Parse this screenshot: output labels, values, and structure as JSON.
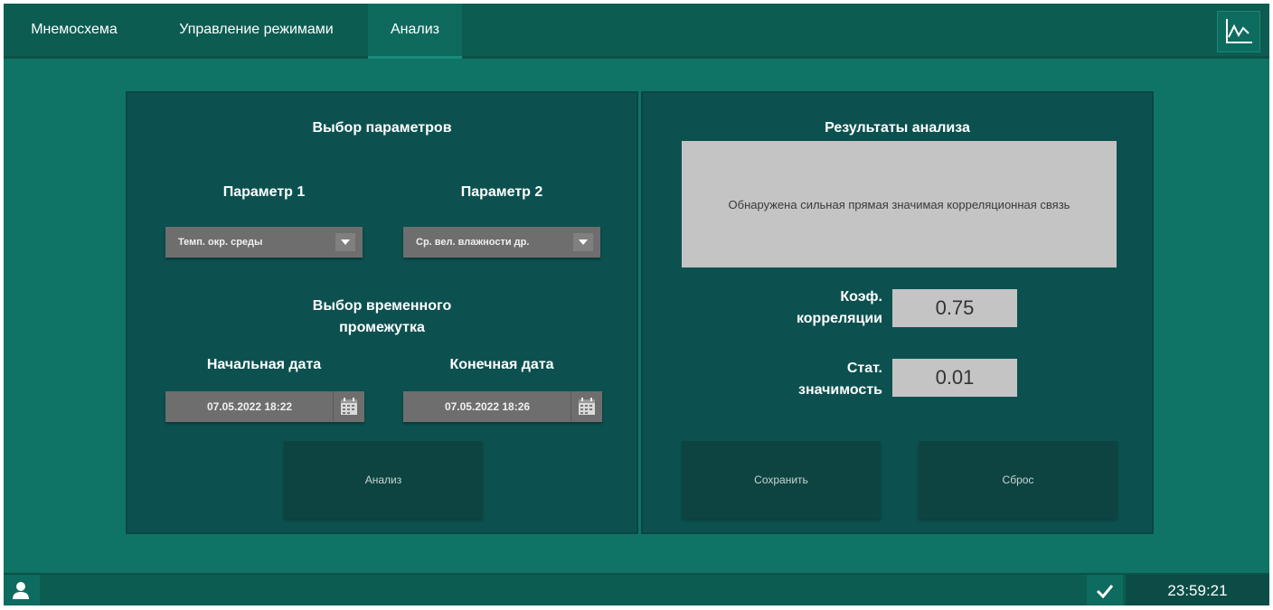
{
  "tabs": [
    {
      "label": "Мнемосхема",
      "active": false
    },
    {
      "label": "Управление режимами",
      "active": false
    },
    {
      "label": "Анализ",
      "active": true
    }
  ],
  "toolbar": {
    "chart_icon": "line-chart-icon"
  },
  "left_panel": {
    "title": "Выбор параметров",
    "param1": {
      "label": "Параметр 1",
      "value": "Темп. окр. среды"
    },
    "param2": {
      "label": "Параметр 2",
      "value": "Ср. вел. влажности др."
    },
    "time_title_line1": "Выбор временного",
    "time_title_line2": "промежутка",
    "start": {
      "label": "Начальная дата",
      "value": "07.05.2022  18:22"
    },
    "end": {
      "label": "Конечная дата",
      "value": "07.05.2022  18:26"
    },
    "analyze_button": "Анализ"
  },
  "right_panel": {
    "title": "Результаты анализа",
    "result_text": "Обнаружена сильная прямая значимая корреляционная связь",
    "corr": {
      "label_line1": "Коэф.",
      "label_line2": "корреляции",
      "value": "0.75"
    },
    "sig": {
      "label_line1": "Стат.",
      "label_line2": "значимость",
      "value": "0.01"
    },
    "save_button": "Сохранить",
    "reset_button": "Сброс"
  },
  "statusbar": {
    "time": "23:59:21",
    "user_icon": "user-icon",
    "status_icon": "check-icon"
  },
  "colors": {
    "background": "#0f7466",
    "panel": "#0c5150",
    "field": "#6e6e6e",
    "result_box": "#c4c4c4"
  }
}
